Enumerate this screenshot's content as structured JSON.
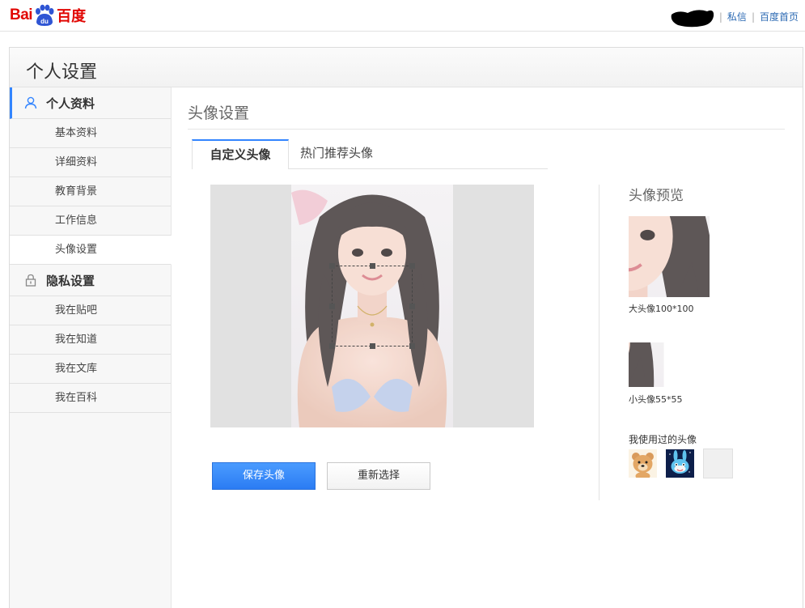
{
  "header": {
    "logo_en": "Bai",
    "logo_du": "du",
    "logo_cn": "百度",
    "links": [
      "私信",
      "百度首页"
    ],
    "separator": "|"
  },
  "panel": {
    "title": "个人设置"
  },
  "sidebar": {
    "groups": [
      {
        "label": "个人资料",
        "icon": "user-icon",
        "items": [
          "基本资料",
          "详细资料",
          "教育背景",
          "工作信息",
          "头像设置"
        ]
      },
      {
        "label": "隐私设置",
        "icon": "lock-icon",
        "items": [
          "我在贴吧",
          "我在知道",
          "我在文库",
          "我在百科"
        ]
      }
    ],
    "current_item": "头像设置"
  },
  "content": {
    "title": "头像设置",
    "tabs": [
      {
        "label": "自定义头像",
        "active": true
      },
      {
        "label": "热门推荐头像",
        "active": false
      }
    ],
    "buttons": {
      "save": "保存头像",
      "reselect": "重新选择"
    }
  },
  "preview": {
    "title": "头像预览",
    "big_label": "大头像100*100",
    "small_label": "小头像55*55",
    "used_label": "我使用过的头像",
    "used_avatars": [
      "bear-avatar-icon",
      "blue-rabbit-avatar-icon"
    ]
  },
  "colors": {
    "brand_red": "#e10602",
    "accent_blue": "#3385ff",
    "link_blue": "#2c6ab3"
  }
}
